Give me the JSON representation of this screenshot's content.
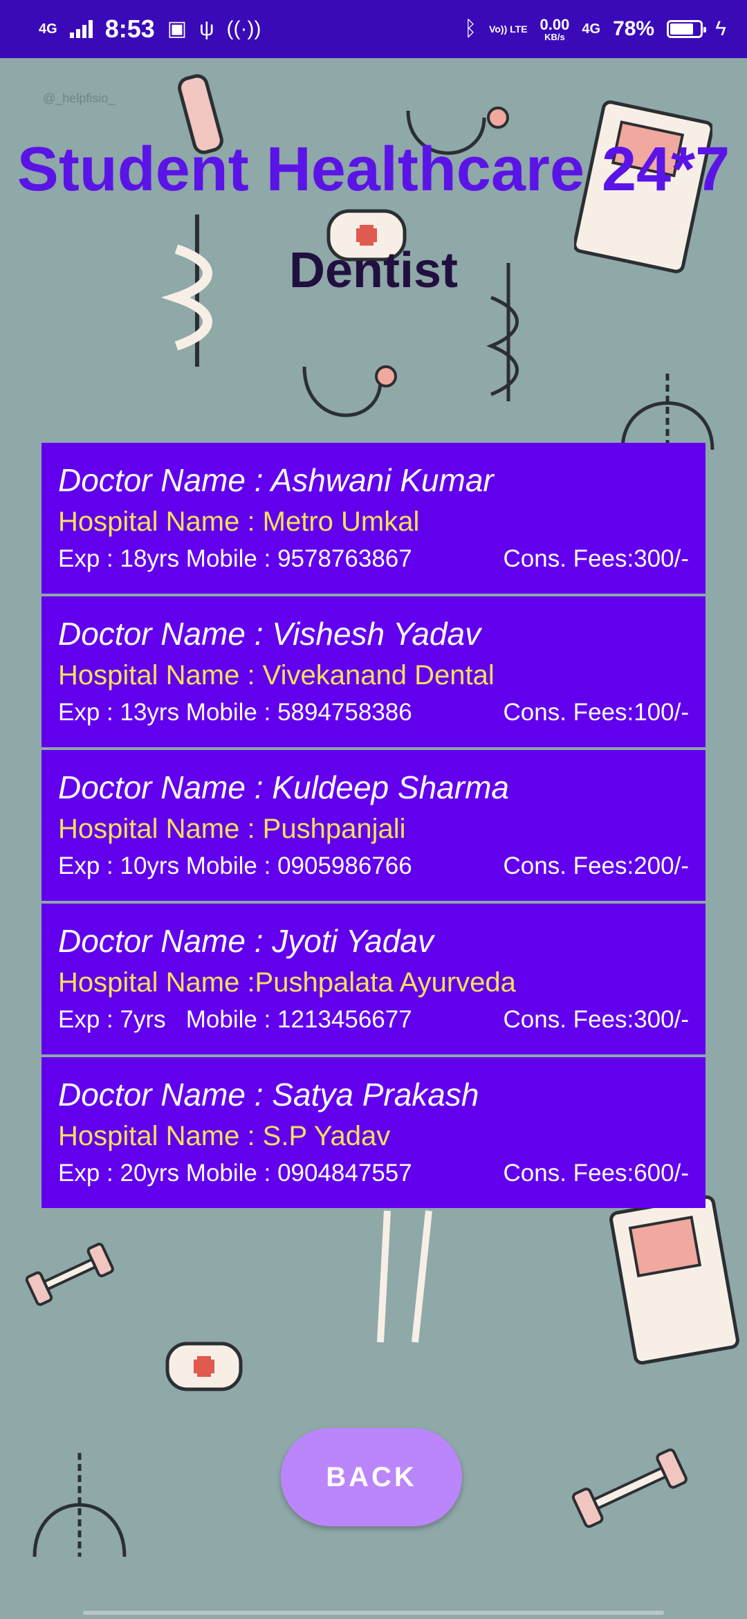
{
  "status_bar": {
    "network": "4G",
    "time": "8:53",
    "data_speed": "0.00",
    "data_speed_unit": "KB/s",
    "volte": "Vo)) LTE",
    "network_right": "4G",
    "battery_percent": "78%",
    "battery_level": 0.78
  },
  "watermark": "@_helpfisio_",
  "app_title": "Student Healthcare 24*7",
  "section_title": "Dentist",
  "doctors": [
    {
      "name": "Doctor Name : Ashwani Kumar",
      "hospital": "Hospital Name : Metro Umkal",
      "exp_mobile": "Exp : 18yrs Mobile : 9578763867",
      "fees": "Cons. Fees:300/-"
    },
    {
      "name": "Doctor Name : Vishesh Yadav",
      "hospital": "Hospital Name : Vivekanand Dental",
      "exp_mobile": "Exp : 13yrs Mobile : 5894758386",
      "fees": "Cons. Fees:100/-"
    },
    {
      "name": "Doctor Name : Kuldeep Sharma",
      "hospital": "Hospital Name : Pushpanjali",
      "exp_mobile": "Exp : 10yrs Mobile : 0905986766",
      "fees": "Cons. Fees:200/-"
    },
    {
      "name": "Doctor Name : Jyoti Yadav",
      "hospital": "Hospital Name :Pushpalata Ayurveda",
      "exp_mobile": "Exp : 7yrs   Mobile : 1213456677",
      "fees": "Cons. Fees:300/-"
    },
    {
      "name": "Doctor Name : Satya Prakash",
      "hospital": "Hospital Name : S.P Yadav",
      "exp_mobile": "Exp : 20yrs Mobile : 0904847557",
      "fees": "Cons. Fees:600/-"
    }
  ],
  "back_button": "BACK",
  "colors": {
    "status_bar": "#3a0ab8",
    "background": "#8fa8a8",
    "title": "#5a14e6",
    "card": "#6200ee",
    "hospital_text": "#f5e25a",
    "back_button": "#bb86fc"
  }
}
